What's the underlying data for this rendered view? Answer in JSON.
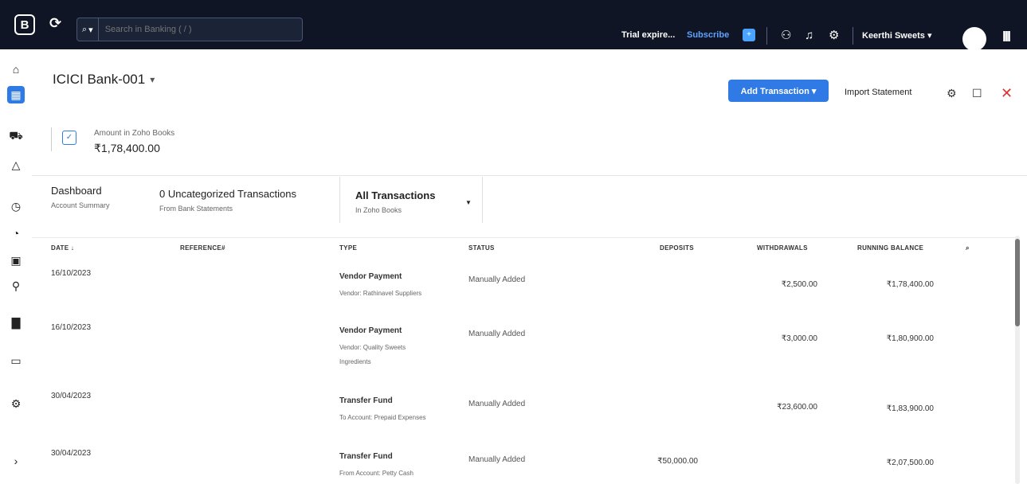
{
  "topbar": {
    "logo": "B",
    "search_placeholder": "Search in Banking ( / )",
    "trial": "Trial expire...",
    "subscribe": "Subscribe",
    "org_name": "Keerthi Sweets"
  },
  "header": {
    "account_name": "ICICI Bank-001",
    "add_transaction": "Add Transaction",
    "import_statement": "Import Statement"
  },
  "amount": {
    "label": "Amount in Zoho Books",
    "value": "₹1,78,400.00"
  },
  "tabs": [
    {
      "label": "Dashboard",
      "sub": "Account Summary"
    },
    {
      "label": "0 Uncategorized Transactions",
      "sub": "From Bank Statements"
    },
    {
      "label": "All Transactions",
      "sub": "In Zoho Books"
    }
  ],
  "table": {
    "headers": {
      "date": "DATE",
      "reference": "REFERENCE#",
      "type": "TYPE",
      "status": "STATUS",
      "deposits": "DEPOSITS",
      "withdrawals": "WITHDRAWALS",
      "running_balance": "RUNNING BALANCE"
    },
    "rows": [
      {
        "date": "16/10/2023",
        "type": "Vendor Payment",
        "sub": "Vendor: Rathinavel Suppliers",
        "sub2": "",
        "status": "Manually Added",
        "deposit": "",
        "withdrawal": "₹2,500.00",
        "balance": "₹1,78,400.00"
      },
      {
        "date": "16/10/2023",
        "type": "Vendor Payment",
        "sub": "Vendor: Quality Sweets",
        "sub2": "Ingredients",
        "status": "Manually Added",
        "deposit": "",
        "withdrawal": "₹3,000.00",
        "balance": "₹1,80,900.00"
      },
      {
        "date": "30/04/2023",
        "type": "Transfer Fund",
        "sub": "To Account: Prepaid Expenses",
        "sub2": "",
        "status": "Manually Added",
        "deposit": "",
        "withdrawal": "₹23,600.00",
        "balance": "₹1,83,900.00"
      },
      {
        "date": "30/04/2023",
        "type": "Transfer Fund",
        "sub": "From Account: Petty Cash",
        "sub2": "",
        "status": "Manually Added",
        "deposit": "₹50,000.00",
        "withdrawal": "",
        "balance": "₹2,07,500.00"
      }
    ]
  },
  "icons": {
    "refresh": "refresh-icon",
    "search": "search-icon",
    "notification": "bell-icon",
    "settings": "gear-icon",
    "users": "users-icon",
    "apps": "apps-grid-icon",
    "close": "close-icon"
  },
  "colors": {
    "topbar": "#0f1524",
    "accent": "#2f7ae5",
    "subscribe": "#5ea2ff",
    "close": "#e03232"
  }
}
